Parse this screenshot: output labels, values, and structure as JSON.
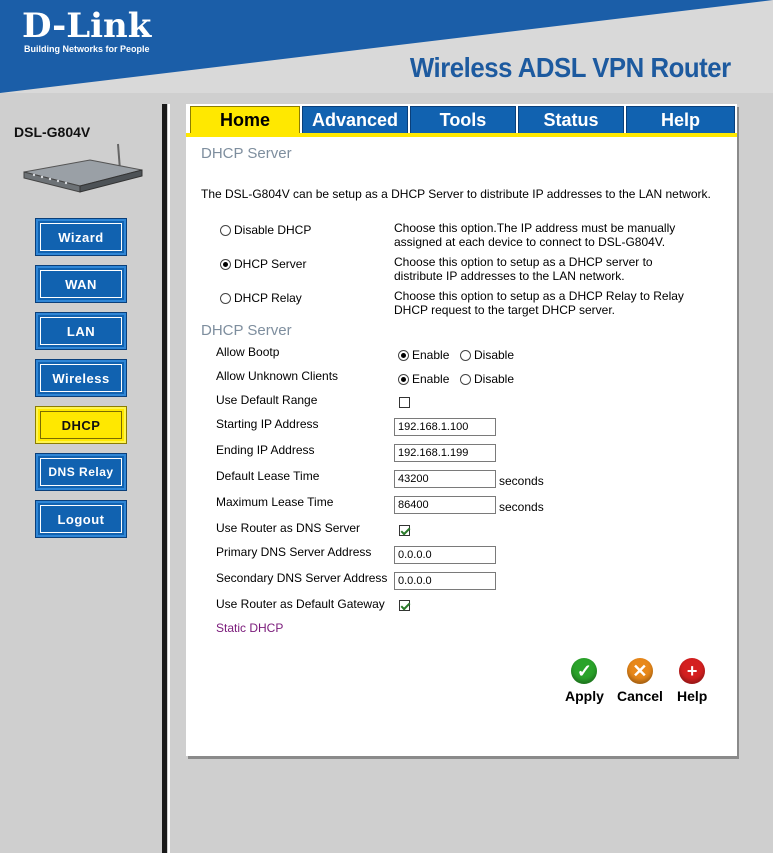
{
  "header": {
    "brand": "D-Link",
    "tagline": "Building Networks for People",
    "product_title": "Wireless ADSL VPN Router"
  },
  "sidebar": {
    "model": "DSL-G804V",
    "items": [
      {
        "label": "Wizard"
      },
      {
        "label": "WAN"
      },
      {
        "label": "LAN"
      },
      {
        "label": "Wireless"
      },
      {
        "label": "DHCP"
      },
      {
        "label": "DNS Relay"
      },
      {
        "label": "Logout"
      }
    ],
    "active_item": "DHCP"
  },
  "tabs": [
    {
      "label": "Home"
    },
    {
      "label": "Advanced"
    },
    {
      "label": "Tools"
    },
    {
      "label": "Status"
    },
    {
      "label": "Help"
    }
  ],
  "main": {
    "section1_title": "DHCP Server",
    "intro": "The DSL-G804V can be setup as a DHCP Server to distribute IP addresses to the LAN network.",
    "modes": [
      {
        "label": "Disable DHCP",
        "checked": false,
        "desc": "Choose this option.The IP address must be manually assigned at each device to connect to DSL-G804V."
      },
      {
        "label": "DHCP Server",
        "checked": true,
        "desc": "Choose this option to setup as a DHCP server to distribute IP addresses to the LAN network."
      },
      {
        "label": "DHCP Relay",
        "checked": false,
        "desc": "Choose this option to setup as a DHCP Relay to Relay DHCP request to the target DHCP server."
      }
    ],
    "section2_title": "DHCP Server",
    "fields": {
      "allow_bootp": {
        "label": "Allow Bootp",
        "enable": "Enable",
        "disable": "Disable",
        "value": "Enable"
      },
      "allow_unknown": {
        "label": "Allow Unknown Clients",
        "enable": "Enable",
        "disable": "Disable",
        "value": "Enable"
      },
      "use_default_range": {
        "label": "Use Default Range",
        "checked": false
      },
      "starting_ip": {
        "label": "Starting IP Address",
        "value": "192.168.1.100"
      },
      "ending_ip": {
        "label": "Ending IP Address",
        "value": "192.168.1.199"
      },
      "default_lease": {
        "label": "Default Lease Time",
        "value": "43200",
        "unit": "seconds"
      },
      "max_lease": {
        "label": "Maximum Lease Time",
        "value": "86400",
        "unit": "seconds"
      },
      "router_dns": {
        "label": "Use Router as DNS Server",
        "checked": true
      },
      "primary_dns": {
        "label": "Primary DNS Server Address",
        "value": "0.0.0.0"
      },
      "secondary_dns": {
        "label": "Secondary DNS Server Address",
        "value": "0.0.0.0"
      },
      "router_gateway": {
        "label": "Use Router as Default Gateway",
        "checked": true
      }
    },
    "static_dhcp_link": "Static DHCP",
    "actions": {
      "apply": "Apply",
      "cancel": "Cancel",
      "help": "Help"
    }
  },
  "colors": {
    "brand_blue": "#1162b0",
    "active_yellow": "#ffe800",
    "title_gray": "#7e8e9e",
    "apply_green": "#2aa32a",
    "cancel_orange": "#e8881a",
    "help_red": "#d42020"
  }
}
